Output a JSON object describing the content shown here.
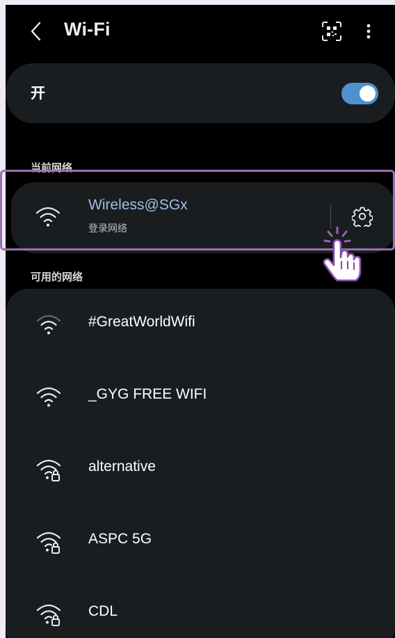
{
  "header": {
    "title": "Wi-Fi",
    "back_icon": "chevron-left-icon",
    "qr_icon": "qr-scan-icon",
    "more_icon": "more-vertical-icon"
  },
  "toggle": {
    "label": "开",
    "state": "on",
    "accent_color": "#4e93d0"
  },
  "current_section": {
    "label": "当前网络",
    "network": {
      "name": "Wireless@SGx",
      "status": "登录网络",
      "name_color": "#9fbfe6",
      "icon": "wifi-icon",
      "settings_icon": "gear-icon"
    }
  },
  "available_section": {
    "label": "可用的网络",
    "networks": [
      {
        "name": "#GreatWorldWifi",
        "icon": "wifi-weak-icon",
        "locked": false
      },
      {
        "name": "_GYG FREE WIFI",
        "icon": "wifi-icon",
        "locked": false
      },
      {
        "name": "alternative",
        "icon": "wifi-lock-icon",
        "locked": true
      },
      {
        "name": "ASPC 5G",
        "icon": "wifi-lock-icon",
        "locked": true
      },
      {
        "name": "CDL",
        "icon": "wifi-lock-icon",
        "locked": true
      }
    ]
  },
  "highlight_color": "#9a70b0"
}
